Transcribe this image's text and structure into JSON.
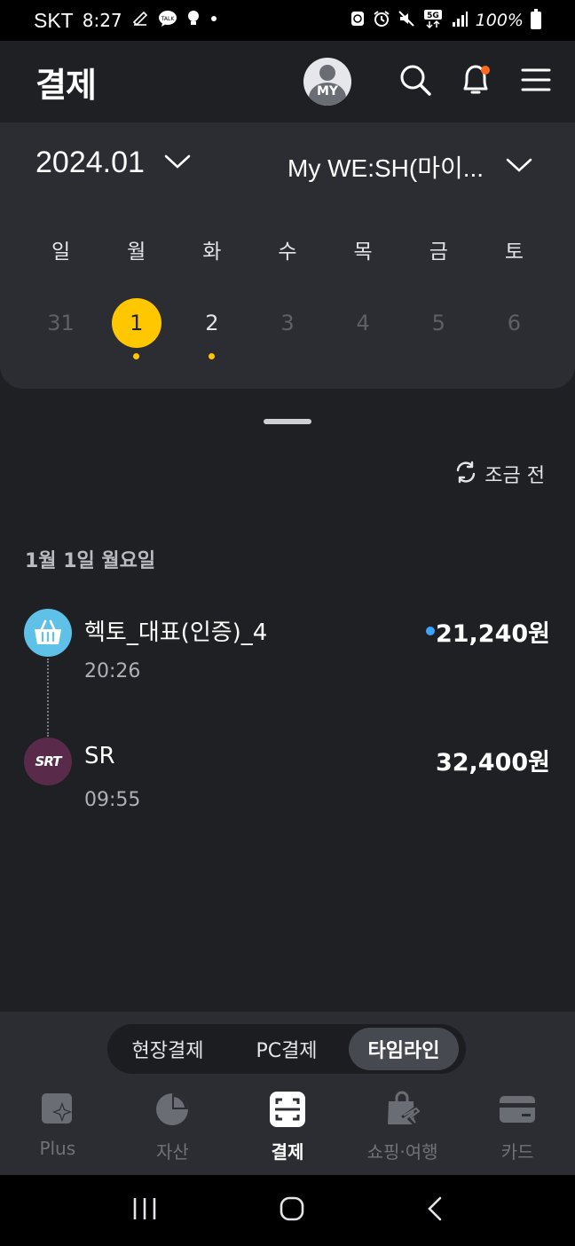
{
  "status_bar": {
    "carrier": "SKT",
    "time": "8:27",
    "network": "5G",
    "battery": "100%"
  },
  "header": {
    "title": "결제",
    "avatar_label": "MY",
    "icons": [
      "search-icon",
      "bell-icon",
      "menu-icon"
    ]
  },
  "calendar": {
    "month": "2024.01",
    "card_name": "My WE:SH(마이...",
    "weekdays": [
      "일",
      "월",
      "화",
      "수",
      "목",
      "금",
      "토"
    ],
    "dates": [
      "31",
      "1",
      "2",
      "3",
      "4",
      "5",
      "6"
    ],
    "selected_date": "1",
    "dates_with_payments": [
      "1",
      "2"
    ]
  },
  "refresh": {
    "label": "조금 전"
  },
  "day_group": {
    "label": "1월 1일 월요일"
  },
  "transactions": [
    {
      "merchant": "헥토_대표(인증)_4",
      "time": "20:26",
      "amount": "21,240원",
      "logo": "shopping-basket-icon",
      "unread": true
    },
    {
      "merchant": "SR",
      "time": "09:55",
      "amount": "32,400원",
      "logo": "SRT",
      "unread": false
    }
  ],
  "segmented_tabs": {
    "items": [
      "현장결제",
      "PC결제",
      "타임라인"
    ],
    "selected": "타임라인"
  },
  "bottom_nav": {
    "items": [
      {
        "label": "Plus",
        "icon": "sparkle-icon"
      },
      {
        "label": "자산",
        "icon": "pie-chart-icon"
      },
      {
        "label": "결제",
        "icon": "scan-icon"
      },
      {
        "label": "쇼핑·여행",
        "icon": "shopping-travel-icon"
      },
      {
        "label": "카드",
        "icon": "card-icon"
      }
    ],
    "active": "결제"
  },
  "colors": {
    "accent": "#ffc700",
    "background": "#1f2024",
    "card_bg": "#2c2d32",
    "unread_dot": "#3ea2ff",
    "notification_dot": "#ff6a1f"
  }
}
